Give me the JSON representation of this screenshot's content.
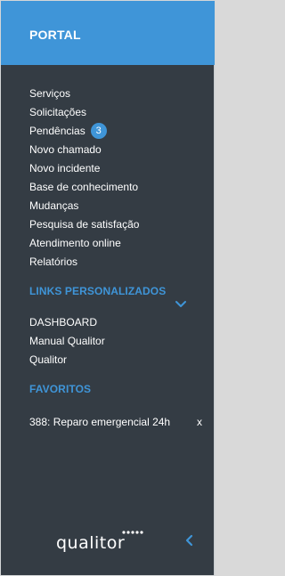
{
  "header": {
    "title": "PORTAL"
  },
  "menu": {
    "items": [
      {
        "label": "Serviços"
      },
      {
        "label": "Solicitações"
      },
      {
        "label": "Pendências",
        "badge": "3"
      },
      {
        "label": "Novo chamado"
      },
      {
        "label": "Novo incidente"
      },
      {
        "label": "Base de conhecimento"
      },
      {
        "label": "Mudanças"
      },
      {
        "label": "Pesquisa de satisfação"
      },
      {
        "label": "Atendimento online"
      },
      {
        "label": "Relatórios"
      }
    ]
  },
  "links_section": {
    "title": "LINKS PERSONALIZADOS",
    "toggle_icon": "chevron-down-icon",
    "items": [
      {
        "label": "DASHBOARD"
      },
      {
        "label": "Manual Qualitor"
      },
      {
        "label": "Qualitor"
      }
    ]
  },
  "favorites": {
    "title": "FAVORITOS",
    "items": [
      {
        "label": "388: Reparo emergencial 24h",
        "remove_label": "x"
      }
    ]
  },
  "footer": {
    "logo_text": "qualitor",
    "collapse_icon": "chevron-left-icon"
  },
  "colors": {
    "accent": "#3f95d8",
    "sidebar_bg": "#343c44",
    "text": "#ffffff"
  }
}
